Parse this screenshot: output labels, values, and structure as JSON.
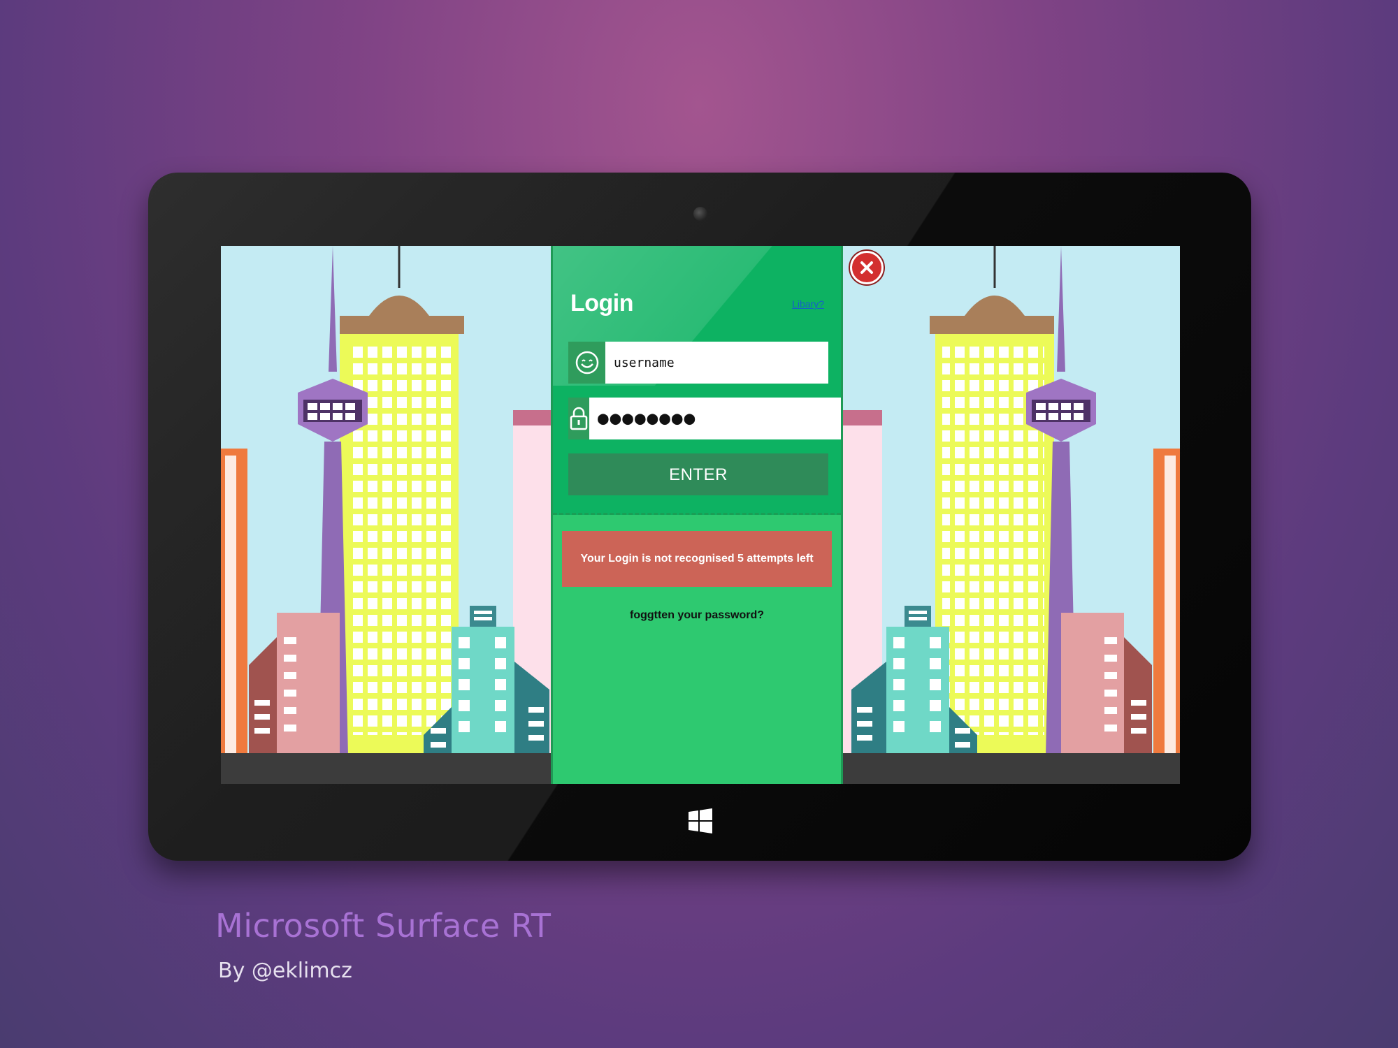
{
  "device": {
    "name": "Microsoft Surface RT",
    "credit": "By @eklimcz"
  },
  "login": {
    "title": "Login",
    "library_link": "Libary?",
    "username_value": "username",
    "password_value": "●●●●●●●●",
    "enter_label": "ENTER",
    "error_message": "Your Login is not recognised 5 attempts left",
    "forgot_label": "foggtten your password?"
  },
  "icons": {
    "username": "smiley-icon",
    "password": "lock-icon",
    "close": "close-icon",
    "home": "windows-logo-icon",
    "camera": "camera-icon"
  },
  "colors": {
    "panel": "#2ec970",
    "panel_top": "#0db262",
    "button": "#2f8b59",
    "error": "#cc6457",
    "close": "#d32f2f",
    "caption": "#a872d4"
  }
}
